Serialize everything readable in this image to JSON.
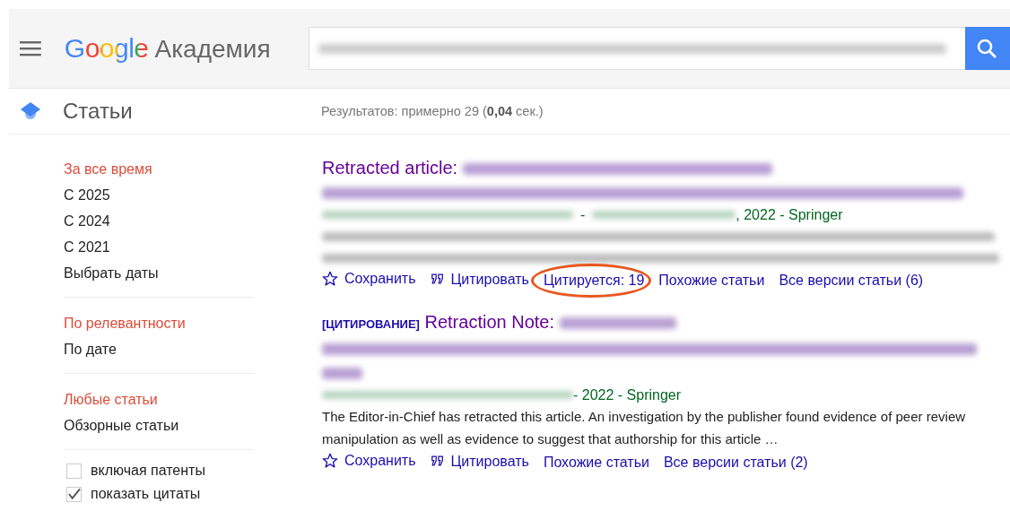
{
  "header": {
    "brand": "Google",
    "product": "Академия"
  },
  "section": {
    "label": "Статьи"
  },
  "results_count": {
    "prefix": "Результатов: примерно 29 (",
    "time": "0,04",
    "suffix": " сек.)"
  },
  "sidebar": {
    "groups": [
      {
        "items": [
          {
            "label": "За все время",
            "selected": true
          },
          {
            "label": "С 2025",
            "selected": false
          },
          {
            "label": "С 2024",
            "selected": false
          },
          {
            "label": "С 2021",
            "selected": false
          },
          {
            "label": "Выбрать даты",
            "selected": false
          }
        ]
      },
      {
        "items": [
          {
            "label": "По релевантности",
            "selected": true
          },
          {
            "label": "По дате",
            "selected": false
          }
        ]
      },
      {
        "items": [
          {
            "label": "Любые статьи",
            "selected": true
          },
          {
            "label": "Обзорные статьи",
            "selected": false
          }
        ]
      }
    ],
    "options": [
      {
        "label": "включая патенты",
        "checked": false
      },
      {
        "label": "показать цитаты",
        "checked": true
      }
    ]
  },
  "results": [
    {
      "kind": "article",
      "title_prefix": "Retracted article:",
      "separator": "-",
      "meta": ", 2022 - Springer",
      "actions": [
        {
          "kind": "save",
          "label": "Сохранить",
          "circled": false
        },
        {
          "kind": "cite",
          "label": "Цитировать",
          "circled": false
        },
        {
          "kind": "link",
          "label": "Цитируется: 19",
          "circled": true
        },
        {
          "kind": "link",
          "label": "Похожие статьи",
          "circled": false
        },
        {
          "kind": "link",
          "label": "Все версии статьи (6)",
          "circled": false
        }
      ]
    },
    {
      "kind": "citation",
      "tag": "[ЦИТИРОВАНИЕ]",
      "title_prefix": "Retraction Note:",
      "meta": "- 2022 - Springer",
      "snippet": "The Editor-in-Chief has retracted this article. An investigation by the publisher found evidence of peer review manipulation as well as evidence to suggest that authorship for this article …",
      "actions": [
        {
          "kind": "save",
          "label": "Сохранить",
          "circled": false
        },
        {
          "kind": "cite",
          "label": "Цитировать",
          "circled": false
        },
        {
          "kind": "link",
          "label": "Похожие статьи",
          "circled": false
        },
        {
          "kind": "link",
          "label": "Все версии статьи (2)",
          "circled": false
        }
      ]
    }
  ]
}
